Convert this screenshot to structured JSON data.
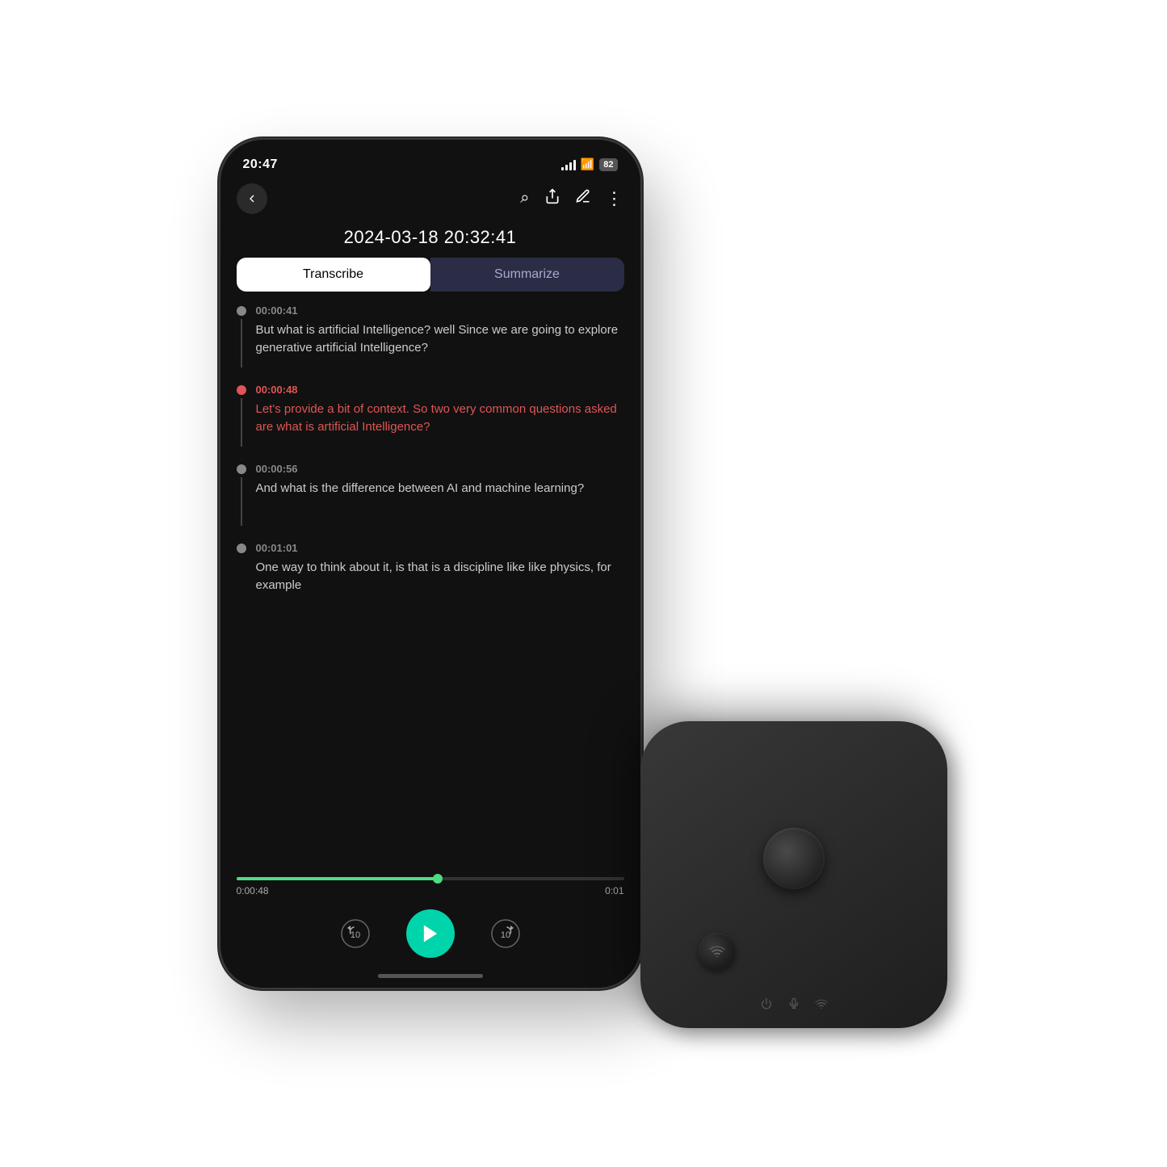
{
  "scene": {
    "background": "#ffffff"
  },
  "phone": {
    "status_bar": {
      "time": "20:47",
      "battery": "82"
    },
    "nav": {
      "back_label": "back"
    },
    "recording_title": "2024-03-18 20:32:41",
    "tabs": [
      {
        "id": "transcribe",
        "label": "Transcribe",
        "active": true
      },
      {
        "id": "summarize",
        "label": "Summarize",
        "active": false
      }
    ],
    "transcript_items": [
      {
        "id": "item1",
        "timestamp": "00:00:41",
        "text": "But what is artificial Intelligence? well Since we are going to explore generative artificial Intelligence?",
        "active": false
      },
      {
        "id": "item2",
        "timestamp": "00:00:48",
        "text": "Let's provide a bit of context. So two very common questions asked are what is artificial Intelligence?",
        "active": true
      },
      {
        "id": "item3",
        "timestamp": "00:00:56",
        "text": "And what is the difference between AI and machine learning?",
        "active": false
      },
      {
        "id": "item4",
        "timestamp": "00:01:01",
        "text": "One way to think about it, is that is a discipline like like physics, for example",
        "active": false
      }
    ],
    "playback": {
      "current_time": "0:00:48",
      "total_time": "0:01",
      "progress_percent": 52
    }
  }
}
